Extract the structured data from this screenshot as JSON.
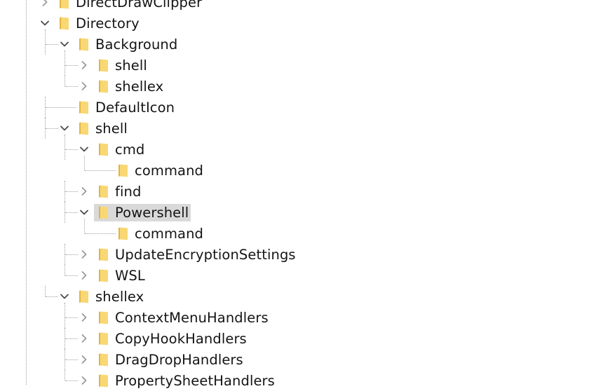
{
  "tree": {
    "nodes": [
      {
        "label": "DirectDrawClipper",
        "depth": 0,
        "state": "collapsed"
      },
      {
        "label": "Directory",
        "depth": 0,
        "state": "expanded"
      },
      {
        "label": "Background",
        "depth": 1,
        "state": "expanded"
      },
      {
        "label": "shell",
        "depth": 2,
        "state": "collapsed"
      },
      {
        "label": "shellex",
        "depth": 2,
        "state": "collapsed"
      },
      {
        "label": "DefaultIcon",
        "depth": 1,
        "state": "leaf"
      },
      {
        "label": "shell",
        "depth": 1,
        "state": "expanded"
      },
      {
        "label": "cmd",
        "depth": 2,
        "state": "expanded"
      },
      {
        "label": "command",
        "depth": 3,
        "state": "leaf"
      },
      {
        "label": "find",
        "depth": 2,
        "state": "collapsed"
      },
      {
        "label": "Powershell",
        "depth": 2,
        "state": "expanded",
        "selected": true
      },
      {
        "label": "command",
        "depth": 3,
        "state": "leaf"
      },
      {
        "label": "UpdateEncryptionSettings",
        "depth": 2,
        "state": "collapsed"
      },
      {
        "label": "WSL",
        "depth": 2,
        "state": "collapsed"
      },
      {
        "label": "shellex",
        "depth": 1,
        "state": "expanded"
      },
      {
        "label": "ContextMenuHandlers",
        "depth": 2,
        "state": "collapsed"
      },
      {
        "label": "CopyHookHandlers",
        "depth": 2,
        "state": "collapsed"
      },
      {
        "label": "DragDropHandlers",
        "depth": 2,
        "state": "collapsed"
      },
      {
        "label": "PropertySheetHandlers",
        "depth": 2,
        "state": "collapsed"
      }
    ]
  },
  "colors": {
    "selection": "#d9d9d9",
    "folder_fill": "#f8d775",
    "folder_dark": "#e3b341",
    "guide": "#a0a0a0",
    "chevron_expanded": "#4a4a4a",
    "chevron_collapsed": "#9a9a9a"
  },
  "icons": {
    "folder": "folder-icon",
    "expanded": "chevron-down-icon",
    "collapsed": "chevron-right-icon"
  }
}
